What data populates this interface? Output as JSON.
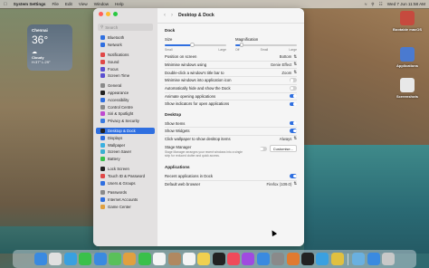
{
  "menubar": {
    "app_name": "System Settings",
    "menus": [
      "File",
      "Edit",
      "View",
      "Window",
      "Help"
    ],
    "datetime": "Wed 7 Jun  11:58 AM"
  },
  "weather": {
    "city": "Chennai",
    "temperature": "36°",
    "condition": "Cloudy",
    "high_low": "H:37° L:29°"
  },
  "desktop_icons": [
    {
      "label": "Bootable macOS",
      "color": "#c64a3e"
    },
    {
      "label": "Applications",
      "color": "#4a7ad0"
    },
    {
      "label": "Screenshots",
      "color": "#e8e8e8"
    }
  ],
  "search": {
    "placeholder": "Search"
  },
  "sidebar": {
    "items": [
      {
        "label": "Bluetooth",
        "color": "#2f6fe0"
      },
      {
        "label": "Network",
        "color": "#2f6fe0"
      },
      {
        "label": "Notifications",
        "color": "#e04848"
      },
      {
        "label": "Sound",
        "color": "#e04848"
      },
      {
        "label": "Focus",
        "color": "#5b4fd0"
      },
      {
        "label": "Screen Time",
        "color": "#5b4fd0"
      },
      {
        "label": "General",
        "color": "#8a8a8a"
      },
      {
        "label": "Appearance",
        "color": "#222222"
      },
      {
        "label": "Accessibility",
        "color": "#2f6fe0"
      },
      {
        "label": "Control Centre",
        "color": "#8a8a8a"
      },
      {
        "label": "Siri & Spotlight",
        "color": "#c04ad0"
      },
      {
        "label": "Privacy & Security",
        "color": "#3a7ae0"
      },
      {
        "label": "Desktop & Dock",
        "color": "#222222"
      },
      {
        "label": "Displays",
        "color": "#2f6fe0"
      },
      {
        "label": "Wallpaper",
        "color": "#3ab0e0"
      },
      {
        "label": "Screen Saver",
        "color": "#3ab0d0"
      },
      {
        "label": "Battery",
        "color": "#3ac04a"
      },
      {
        "label": "Lock Screen",
        "color": "#222222"
      },
      {
        "label": "Touch ID & Password",
        "color": "#e04848"
      },
      {
        "label": "Users & Groups",
        "color": "#2f6fe0"
      },
      {
        "label": "Passwords",
        "color": "#8a8a8a"
      },
      {
        "label": "Internet Accounts",
        "color": "#2f6fe0"
      },
      {
        "label": "Game Center",
        "color": "#e0a040"
      }
    ],
    "active": "Desktop & Dock"
  },
  "content": {
    "title": "Desktop & Dock",
    "dock_section": "Dock",
    "size_label": "Size",
    "magnification_label": "Magnification",
    "size_small": "Small",
    "size_large": "Large",
    "mag_off": "Off",
    "mag_small": "Small",
    "mag_large": "Large",
    "size_value": 0.45,
    "magnification_value": 0.1,
    "rows_dock": [
      {
        "label": "Position on screen",
        "value": "Bottom",
        "kind": "select"
      },
      {
        "label": "Minimise windows using",
        "value": "Genie Effect",
        "kind": "select"
      },
      {
        "label": "Double-click a window's title bar to",
        "value": "Zoom",
        "kind": "select"
      },
      {
        "label": "Minimise windows into application icon",
        "value": "",
        "kind": "toggle-off"
      },
      {
        "label": "Automatically hide and show the Dock",
        "value": "",
        "kind": "toggle-off"
      },
      {
        "label": "Animate opening applications",
        "value": "",
        "kind": "toggle-on"
      },
      {
        "label": "Show indicators for open applications",
        "value": "",
        "kind": "toggle-on"
      }
    ],
    "desktop_section": "Desktop",
    "rows_desktop": [
      {
        "label": "Show Items",
        "value": "",
        "kind": "toggle-on"
      },
      {
        "label": "Show Widgets",
        "value": "",
        "kind": "toggle-on"
      },
      {
        "label": "Click wallpaper to show desktop items",
        "value": "Always",
        "kind": "select"
      }
    ],
    "stage_manager": {
      "title": "Stage Manager",
      "description": "Stage Manager arranges your recent windows into a single strip for reduced clutter and quick access.",
      "button": "Customise..."
    },
    "applications_section": "Applications",
    "rows_apps": [
      {
        "label": "Recent applications in Dock",
        "value": "",
        "kind": "toggle-on"
      },
      {
        "label": "Default web browser",
        "value": "Firefox (109.0)",
        "kind": "select"
      }
    ]
  },
  "dock": {
    "apps": [
      {
        "name": "finder-icon",
        "color": "#3a8ae0"
      },
      {
        "name": "launchpad-icon",
        "color": "#e0e0e0"
      },
      {
        "name": "safari-icon",
        "color": "#3aa0e0"
      },
      {
        "name": "messages-icon",
        "color": "#3ac04a"
      },
      {
        "name": "mail-icon",
        "color": "#3a8ae0"
      },
      {
        "name": "maps-icon",
        "color": "#5ac05a"
      },
      {
        "name": "photos-icon",
        "color": "#e0a040"
      },
      {
        "name": "facetime-icon",
        "color": "#3ac04a"
      },
      {
        "name": "calendar-icon",
        "color": "#f4f4f4"
      },
      {
        "name": "contacts-icon",
        "color": "#b08860"
      },
      {
        "name": "reminders-icon",
        "color": "#f4f4f4"
      },
      {
        "name": "notes-icon",
        "color": "#f0d050"
      },
      {
        "name": "tv-icon",
        "color": "#222222"
      },
      {
        "name": "music-icon",
        "color": "#f04a5a"
      },
      {
        "name": "podcasts-icon",
        "color": "#a04ae0"
      },
      {
        "name": "app-store-icon",
        "color": "#3a8ae0"
      },
      {
        "name": "system-settings-icon",
        "color": "#8a8a8a"
      },
      {
        "name": "firefox-icon",
        "color": "#e07a30"
      },
      {
        "name": "terminal-icon",
        "color": "#222222"
      },
      {
        "name": "telegram-icon",
        "color": "#3aa0e0"
      },
      {
        "name": "chrome-icon",
        "color": "#e0c040"
      },
      {
        "name": "folder-icon",
        "color": "#6ab0e0"
      },
      {
        "name": "downloads-icon",
        "color": "#3a8ae0"
      },
      {
        "name": "trash-icon",
        "color": "#c8c8c8"
      }
    ]
  }
}
